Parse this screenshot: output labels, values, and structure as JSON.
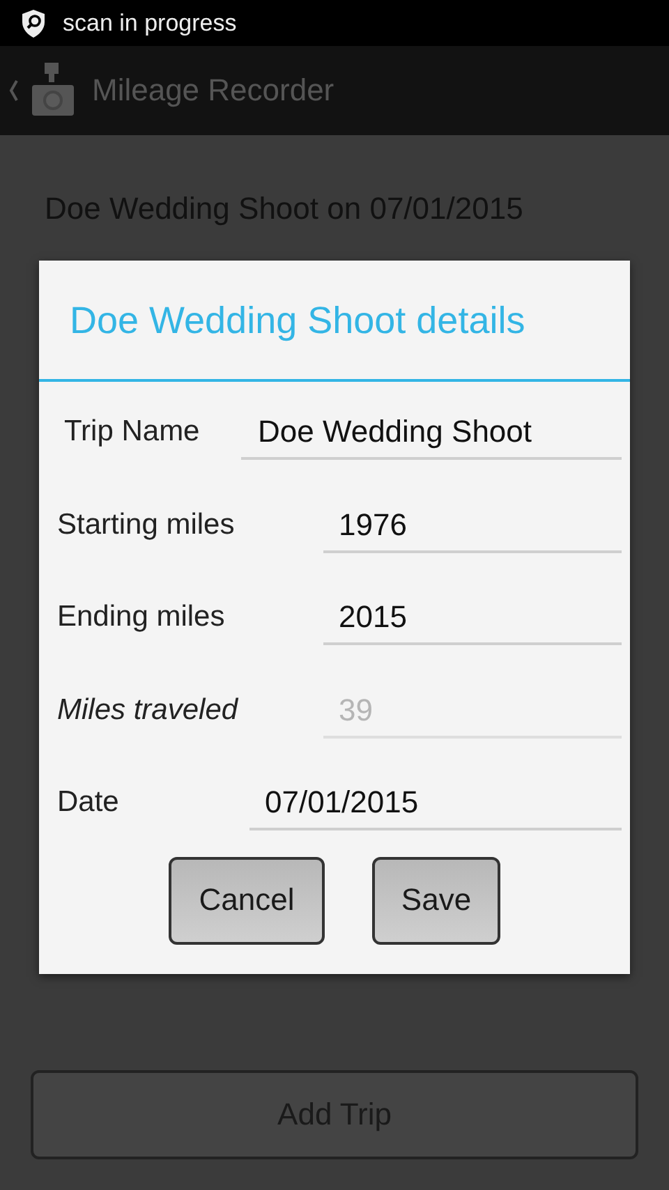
{
  "status_bar": {
    "notification": "scan in progress"
  },
  "action_bar": {
    "title": "Mileage Recorder"
  },
  "trip_heading": "Doe Wedding Shoot on 07/01/2015",
  "dialog": {
    "title": "Doe Wedding Shoot details",
    "fields": [
      {
        "label": "Trip Name",
        "value": "Doe Wedding Shoot",
        "disabled": false
      },
      {
        "label": "Starting miles",
        "value": "1976",
        "disabled": false
      },
      {
        "label": "Ending miles",
        "value": "2015",
        "disabled": false
      },
      {
        "label": "Miles traveled",
        "value": "39",
        "disabled": true
      },
      {
        "label": "Date",
        "value": "07/01/2015",
        "disabled": false
      }
    ],
    "buttons": [
      "Cancel",
      "Save"
    ]
  },
  "add_button": "Add Trip"
}
